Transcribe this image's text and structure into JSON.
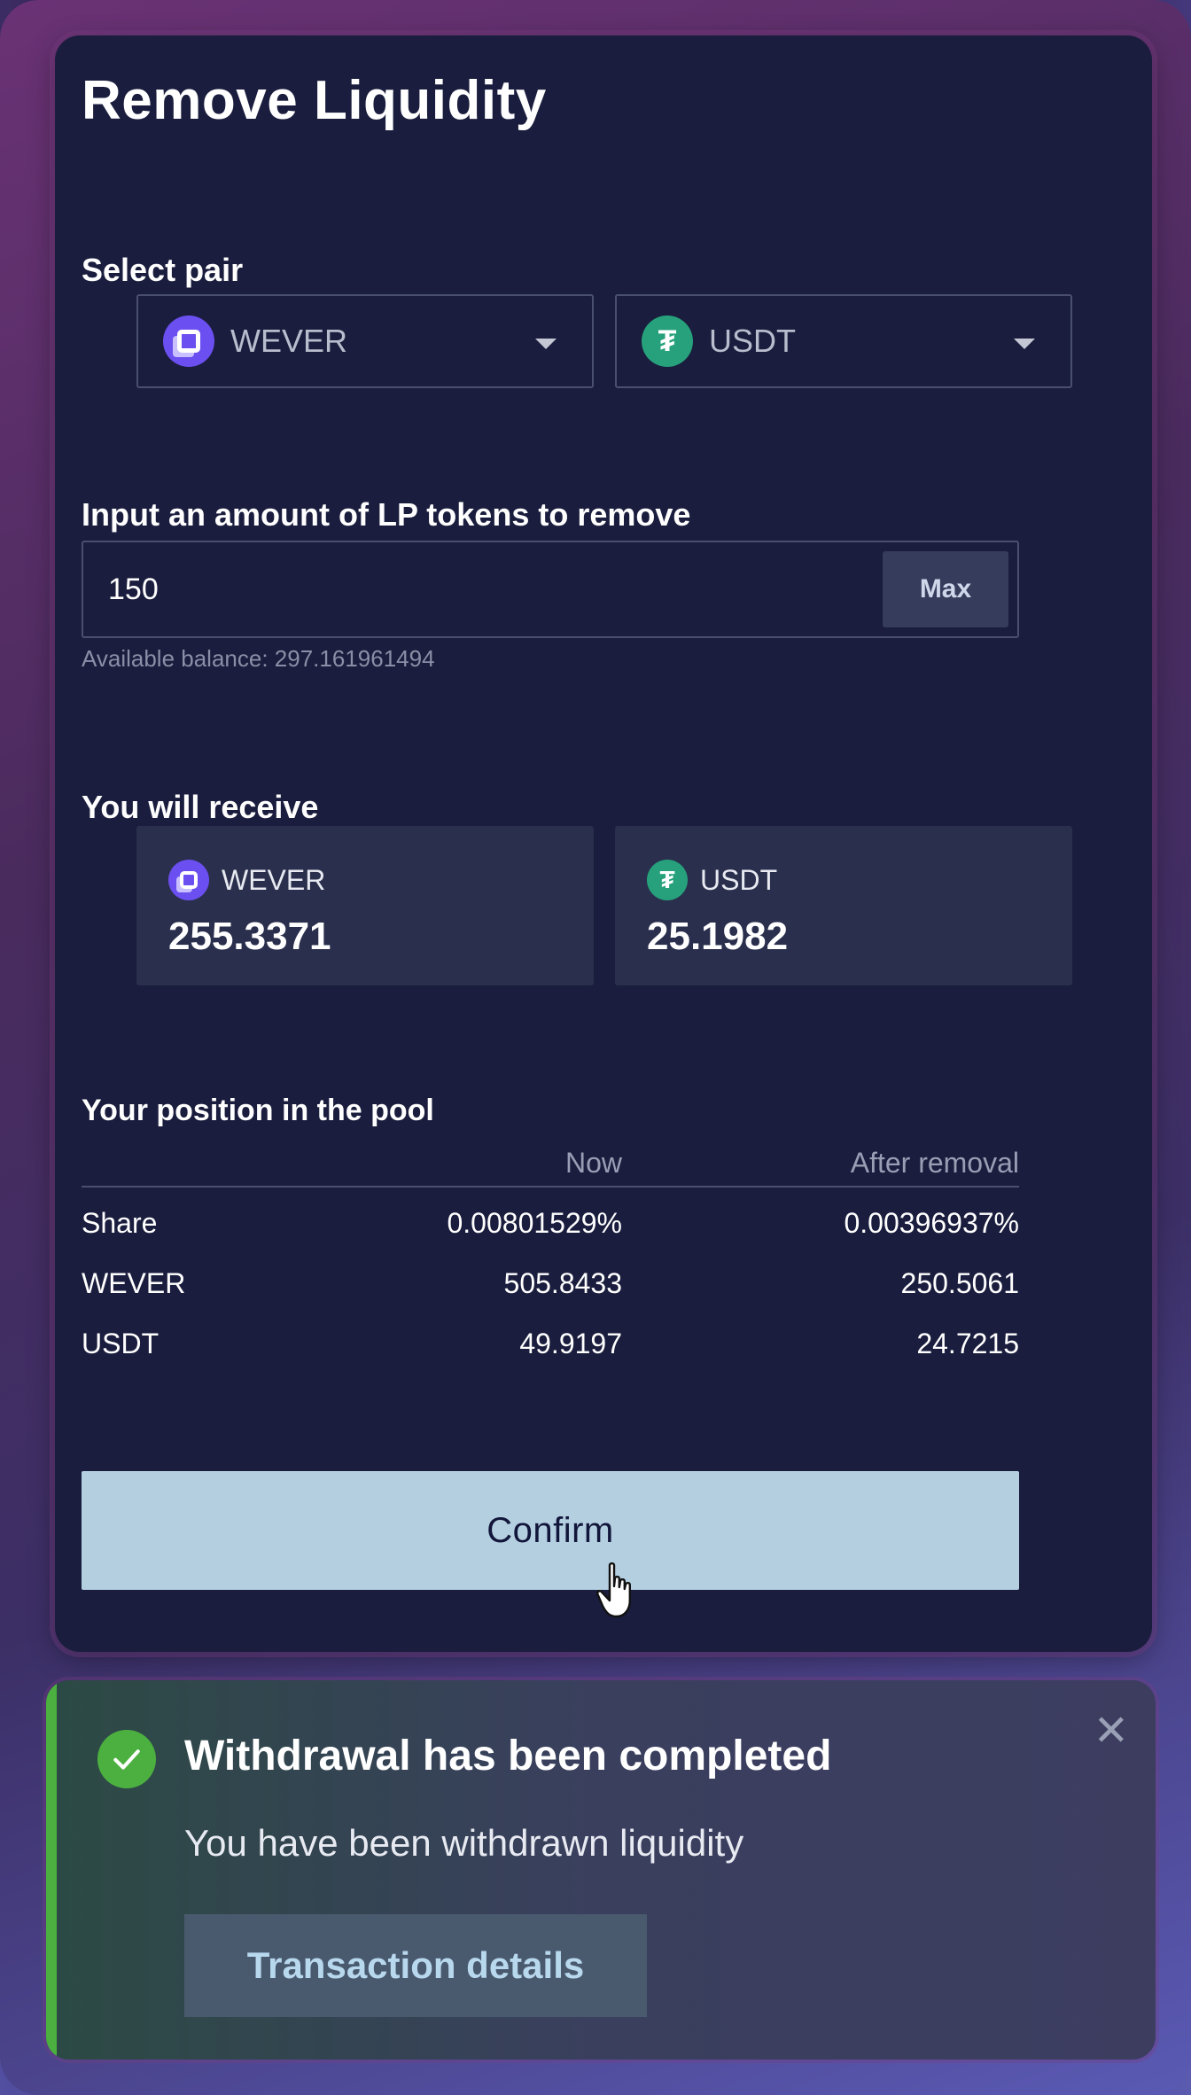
{
  "title": "Remove Liquidity",
  "select_pair": {
    "label": "Select pair",
    "token_a": "WEVER",
    "token_b": "USDT"
  },
  "amount": {
    "label": "Input an amount of LP tokens to remove",
    "value": "150",
    "max_label": "Max",
    "balance_text": "Available balance: 297.161961494"
  },
  "receive": {
    "label": "You will receive",
    "items": [
      {
        "token": "WEVER",
        "value": "255.3371"
      },
      {
        "token": "USDT",
        "value": "25.1982"
      }
    ]
  },
  "position": {
    "label": "Your position in the pool",
    "col_now": "Now",
    "col_after": "After removal",
    "rows": [
      {
        "name": "Share",
        "now": "0.00801529%",
        "after": "0.00396937%"
      },
      {
        "name": "WEVER",
        "now": "505.8433",
        "after": "250.5061"
      },
      {
        "name": "USDT",
        "now": "49.9197",
        "after": "24.7215"
      }
    ]
  },
  "confirm_label": "Confirm",
  "toast": {
    "title": "Withdrawal has been completed",
    "message": "You have been withdrawn liquidity",
    "button": "Transaction details",
    "close": "✕"
  },
  "colors": {
    "card_bg": "#1a1d3d",
    "confirm_bg": "#b4cfe0",
    "success": "#4cb040",
    "wever": "#6b4ff0",
    "usdt": "#26a17b"
  }
}
